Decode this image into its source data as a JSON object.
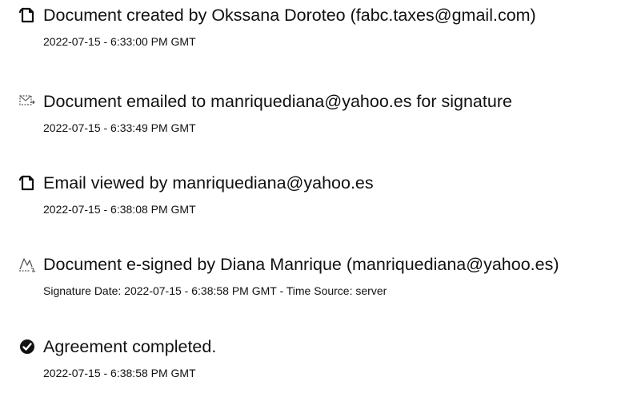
{
  "events": [
    {
      "icon": "document-icon",
      "title": "Document created by Okssana Doroteo (fabc.taxes@gmail.com)",
      "meta": "2022-07-15 - 6:33:00 PM GMT"
    },
    {
      "icon": "email-icon",
      "title": "Document emailed to manriquediana@yahoo.es for signature",
      "meta": "2022-07-15 - 6:33:49 PM GMT"
    },
    {
      "icon": "document-icon",
      "title": "Email viewed by manriquediana@yahoo.es",
      "meta": "2022-07-15 - 6:38:08 PM GMT"
    },
    {
      "icon": "signature-icon",
      "title": "Document e-signed by Diana Manrique (manriquediana@yahoo.es)",
      "meta": "Signature Date: 2022-07-15 - 6:38:58 PM GMT - Time Source: server"
    },
    {
      "icon": "checkmark-badge-icon",
      "title": "Agreement completed.",
      "meta": "2022-07-15 - 6:38:58 PM GMT"
    }
  ]
}
